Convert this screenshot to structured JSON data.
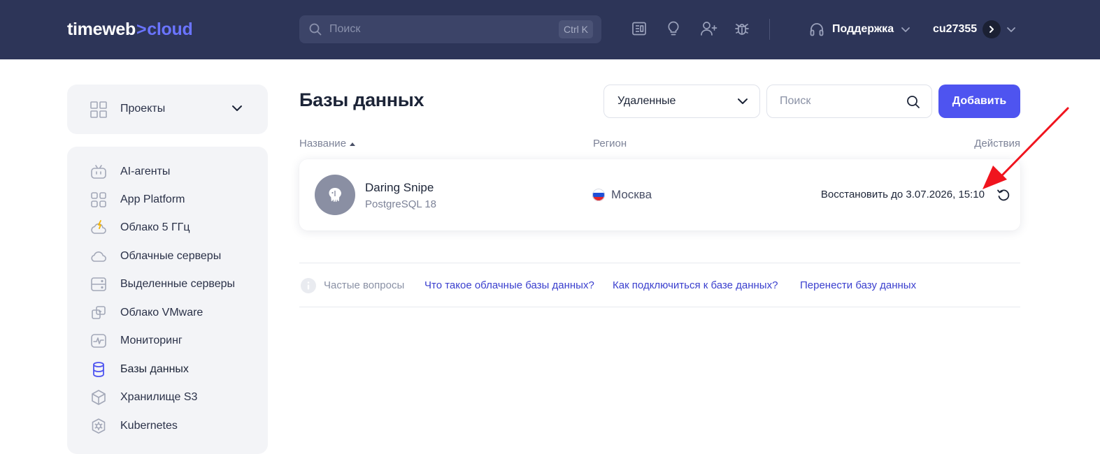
{
  "header": {
    "logo": {
      "part1": "timeweb",
      "separator": ">",
      "part2": "cloud"
    },
    "search": {
      "placeholder": "Поиск",
      "shortcut": "Ctrl K"
    },
    "icons": [
      "docs-icon",
      "lightbulb-icon",
      "add-user-icon",
      "bug-icon"
    ],
    "support_label": "Поддержка",
    "account_id": "cu27355"
  },
  "sidebar": {
    "projects_label": "Проекты",
    "items": [
      {
        "label": "AI-агенты",
        "icon": "robot-icon"
      },
      {
        "label": "App Platform",
        "icon": "apps-grid-icon"
      },
      {
        "label": "Облако 5 ГГц",
        "icon": "cloud-lightning-icon"
      },
      {
        "label": "Облачные серверы",
        "icon": "cloud-icon"
      },
      {
        "label": "Выделенные серверы",
        "icon": "server-icon"
      },
      {
        "label": "Облако VMware",
        "icon": "vmware-icon"
      },
      {
        "label": "Мониторинг",
        "icon": "monitoring-icon"
      },
      {
        "label": "Базы данных",
        "icon": "database-icon",
        "active": true
      },
      {
        "label": "Хранилище S3",
        "icon": "storage-cube-icon"
      },
      {
        "label": "Kubernetes",
        "icon": "kubernetes-icon"
      }
    ]
  },
  "main": {
    "title": "Базы данных",
    "filter_value": "Удаленные",
    "search_placeholder": "Поиск",
    "add_button": "Добавить",
    "columns": {
      "name": "Название",
      "region": "Регион",
      "actions": "Действия"
    },
    "rows": [
      {
        "name": "Daring Snipe",
        "engine": "PostgreSQL 18",
        "region": "Москва",
        "restore_text": "Восстановить до 3.07.2026, 15:10"
      }
    ],
    "faq": {
      "label": "Частые вопросы",
      "links": [
        "Что такое облачные базы данных?",
        "Как подключиться к базе данных?",
        "Перенести базу данных"
      ]
    }
  },
  "colors": {
    "header_bg": "#2d3558",
    "accent": "#4e54f0",
    "link": "#3a3fce",
    "annotation_arrow": "#f0141e"
  }
}
